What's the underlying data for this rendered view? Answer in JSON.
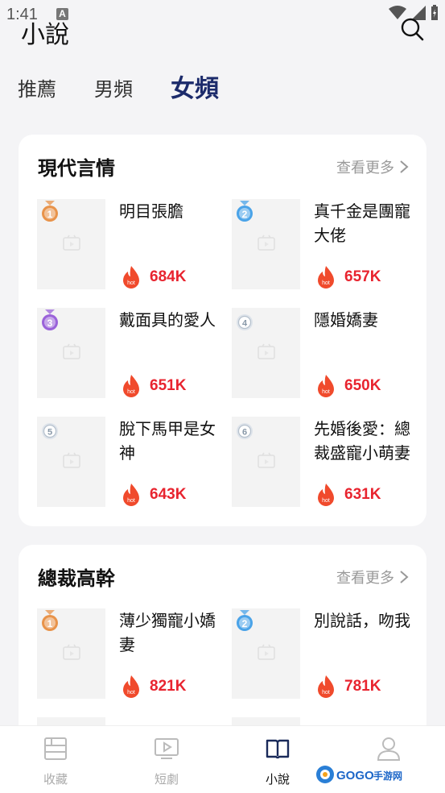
{
  "status": {
    "time": "1:41",
    "indicator": "A"
  },
  "header": {
    "title": "小說",
    "search_icon": "search-icon"
  },
  "tabs": [
    {
      "label": "推薦",
      "active": false
    },
    {
      "label": "男頻",
      "active": false
    },
    {
      "label": "女頻",
      "active": true
    }
  ],
  "sections": [
    {
      "title": "現代言情",
      "more_label": "查看更多",
      "books": [
        {
          "rank": "1",
          "title": "明目張膽",
          "heat": "684K"
        },
        {
          "rank": "2",
          "title": "真千金是團寵大佬",
          "heat": "657K"
        },
        {
          "rank": "3",
          "title": "戴面具的愛人",
          "heat": "651K"
        },
        {
          "rank": "4",
          "title": "隱婚嬌妻",
          "heat": "650K"
        },
        {
          "rank": "5",
          "title": "脫下馬甲是女神",
          "heat": "643K"
        },
        {
          "rank": "6",
          "title": "先婚後愛：總裁盛寵小萌妻",
          "heat": "631K"
        }
      ]
    },
    {
      "title": "總裁高幹",
      "more_label": "查看更多",
      "books": [
        {
          "rank": "1",
          "title": "薄少獨寵小嬌妻",
          "heat": "821K"
        },
        {
          "rank": "2",
          "title": "別說話，吻我",
          "heat": "781K"
        }
      ]
    }
  ],
  "hot_badge": "hot",
  "bottom_nav": [
    {
      "label": "收藏",
      "icon": "bookshelf-icon",
      "active": false
    },
    {
      "label": "短劇",
      "icon": "tv-play-icon",
      "active": false
    },
    {
      "label": "小說",
      "icon": "open-book-icon",
      "active": true
    },
    {
      "label": "",
      "icon": "profile-icon",
      "active": false
    }
  ],
  "watermark": "GOGO手游网",
  "colors": {
    "accent_tab": "#1c2b6b",
    "heat": "#e8242f",
    "flame": "#f04a2c"
  }
}
